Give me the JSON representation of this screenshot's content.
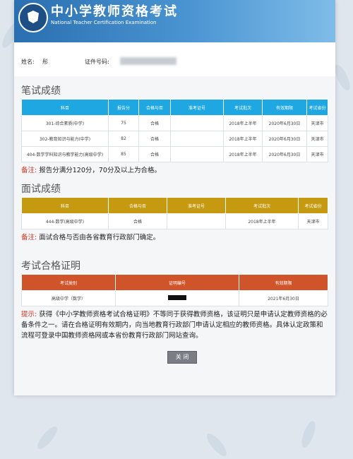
{
  "header": {
    "title": "中小学教师资格考试",
    "subtitle": "National Teacher Certification Examination"
  },
  "identity": {
    "name_label": "姓名:",
    "name_value": "彤",
    "id_label": "证件号码:"
  },
  "written": {
    "title": "笔试成绩",
    "columns": [
      "科目",
      "报告分",
      "合格与否",
      "准考证号",
      "考试批次",
      "有效期限",
      "考试省份"
    ],
    "rows": [
      [
        "301-综合素质(中学)",
        "75",
        "合格",
        "",
        "2018年上半年",
        "2020年6月30日",
        "天津市"
      ],
      [
        "302-教育知识与能力(中学)",
        "82",
        "合格",
        "",
        "2018年上半年",
        "2020年6月30日",
        "天津市"
      ],
      [
        "404-数学学科知识与教学能力(高级中学)",
        "85",
        "合格",
        "",
        "2018年上半年",
        "2020年6月30日",
        "天津市"
      ]
    ],
    "note_label": "备注:",
    "note_text": "报告分满分120分，70分及以上为合格。"
  },
  "interview": {
    "title": "面试成绩",
    "columns": [
      "科目",
      "合格与否",
      "准考证号",
      "考试批次",
      "考试省份"
    ],
    "rows": [
      [
        "444-数学(高级中学)",
        "合格",
        "",
        "2018年上半年",
        "天津市"
      ]
    ],
    "note_label": "备注:",
    "note_text": "面试合格与否由各省教育行政部门确定。"
  },
  "certificate": {
    "title": "考试合格证明",
    "columns": [
      "考试类别",
      "证明编号",
      "有效期限"
    ],
    "rows": [
      [
        "高级中学（数学）",
        "",
        "2021年6月30日"
      ]
    ],
    "tip_label": "提示:",
    "tip_text": "获得《中小学教师资格考试合格证明》不等同于获得教师资格，该证明只是申请认定教师资格的必备条件之一。请在合格证明有效期内，向当地教育行政部门申请认定相应的教师资格。具体认定政策和流程可登录中国教师资格网或本省份教育行政部门网站查询。"
  },
  "actions": {
    "close_label": "关 闭"
  }
}
